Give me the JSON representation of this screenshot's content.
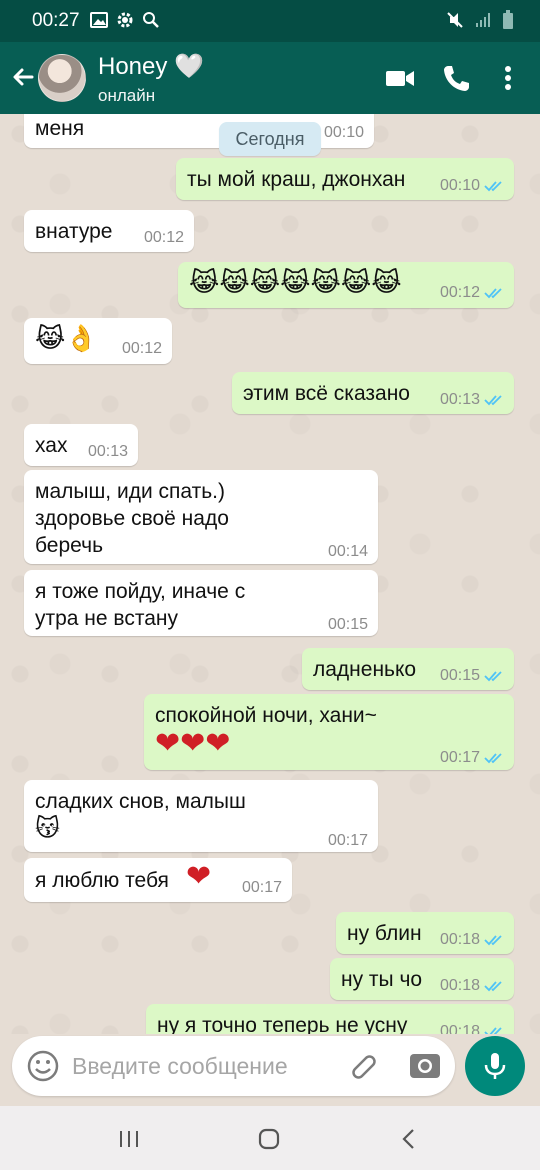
{
  "status_bar": {
    "time": "00:27"
  },
  "header": {
    "contact_name": "Honey 🤍",
    "contact_status": "онлайн"
  },
  "chat": {
    "date_chip": "Сегодня",
    "messages": [
      {
        "dir": "in",
        "text": "меня",
        "time": "00:10"
      },
      {
        "dir": "out",
        "text": "ты мой краш, джонхан",
        "time": "00:10"
      },
      {
        "dir": "in",
        "text": "внатуре",
        "time": "00:12"
      },
      {
        "dir": "out",
        "text": "😹😹😹😹😹😹😹",
        "time": "00:12"
      },
      {
        "dir": "in",
        "text": "😹👌",
        "time": "00:12"
      },
      {
        "dir": "out",
        "text": "этим всё сказано",
        "time": "00:13"
      },
      {
        "dir": "in",
        "text": "хах",
        "time": "00:13"
      },
      {
        "dir": "in",
        "text": "малыш, иди спать.) здоровье своё надо беречь",
        "line1": "малыш, иди спать.)",
        "line2": "здоровье своё надо",
        "line3": "беречь",
        "time": "00:14"
      },
      {
        "dir": "in",
        "text": "я тоже пойду, иначе с утра не встану",
        "line1": "я тоже пойду, иначе с",
        "line2": "утра не встану",
        "time": "00:15"
      },
      {
        "dir": "out",
        "text": "ладненько",
        "time": "00:15"
      },
      {
        "dir": "out",
        "text": "спокойной ночи, хани~ ❤❤❤",
        "line1": "спокойной ночи, хани~",
        "line2": "❤❤❤",
        "time": "00:17"
      },
      {
        "dir": "in",
        "text": "сладких снов, малыш 😽",
        "line1": "сладких снов, малыш",
        "line2": "😽",
        "time": "00:17"
      },
      {
        "dir": "in",
        "text": "я люблю тебя ❤",
        "line1": "я люблю тебя",
        "line2": "❤",
        "time": "00:17"
      },
      {
        "dir": "out",
        "text": "ну блин",
        "time": "00:18"
      },
      {
        "dir": "out",
        "text": "ну ты чо",
        "time": "00:18"
      },
      {
        "dir": "out",
        "text": "ну я точно теперь не усну",
        "time": "00:18"
      }
    ]
  },
  "input": {
    "placeholder": "Введите сообщение"
  },
  "icons": {
    "back": "arrow-left-icon",
    "video": "video-camera-icon",
    "call": "phone-icon",
    "more": "more-vertical-icon",
    "emoji": "smiley-icon",
    "attach": "paperclip-icon",
    "camera": "camera-icon",
    "mic": "microphone-icon"
  },
  "colors": {
    "header": "#075e54",
    "status_bar": "#054d44",
    "incoming_bubble": "#ffffff",
    "outgoing_bubble": "#dcf8c6",
    "read_ticks": "#4fc3f7",
    "mic_button": "#00897b"
  }
}
